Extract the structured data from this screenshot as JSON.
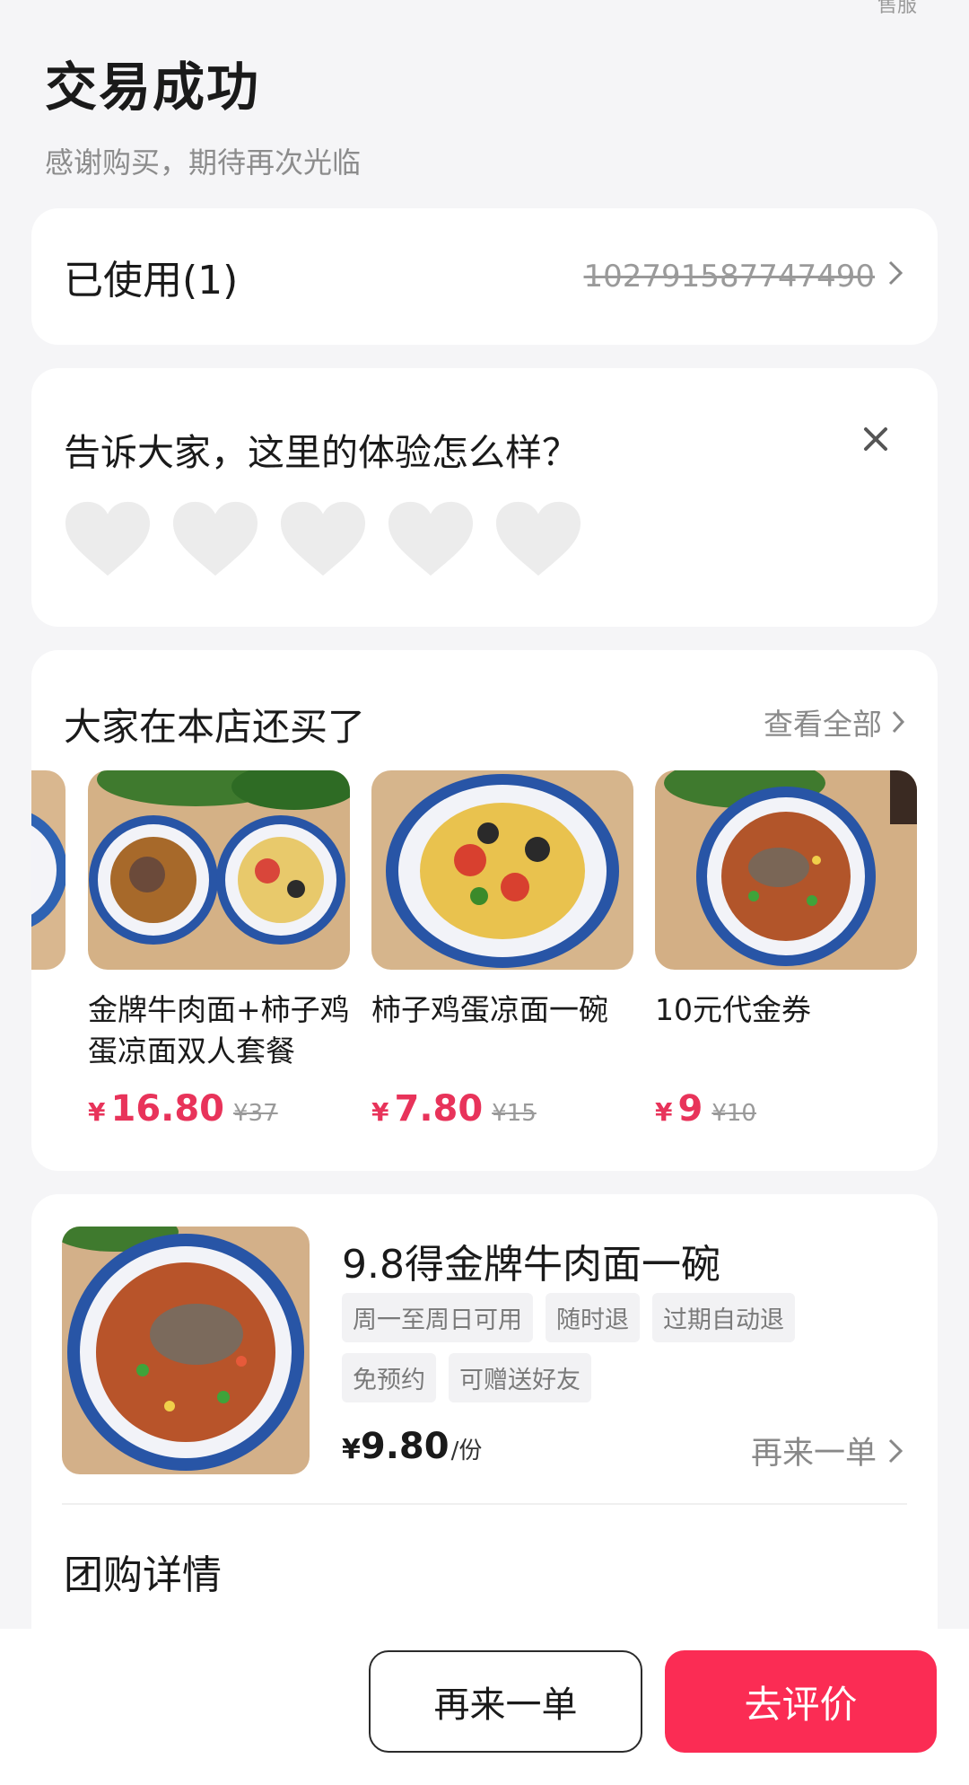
{
  "corner_text": "售服",
  "header": {
    "title": "交易成功",
    "subtitle": "感谢购买，期待再次光临"
  },
  "used": {
    "label": "已使用(1)",
    "code": "102791587747490"
  },
  "rating": {
    "question": "告诉大家，这里的体验怎么样？",
    "close_icon": "close-icon",
    "hearts": 5
  },
  "recommend": {
    "title": "大家在本店还买了",
    "more_label": "查看全部",
    "items": [
      {
        "name": "金牌牛肉面+柿子鸡蛋凉面双人套餐",
        "currency": "¥",
        "price": "16.80",
        "old_price": "¥37"
      },
      {
        "name": "柿子鸡蛋凉面一碗",
        "currency": "¥",
        "price": "7.80",
        "old_price": "¥15"
      },
      {
        "name": "10元代金券",
        "currency": "¥",
        "price": "9",
        "old_price": "¥10"
      }
    ]
  },
  "product": {
    "title": "9.8得金牌牛肉面一碗",
    "tags": [
      "周一至周日可用",
      "随时退",
      "过期自动退",
      "免预约",
      "可赠送好友"
    ],
    "currency": "¥",
    "price": "9.80",
    "unit": "/份",
    "again_label": "再来一单",
    "group_title": "团购详情"
  },
  "bottom": {
    "again_button": "再来一单",
    "review_button": "去评价"
  },
  "colors": {
    "accent": "#fb2c54",
    "price": "#e8335a",
    "background": "#f5f5f7"
  }
}
